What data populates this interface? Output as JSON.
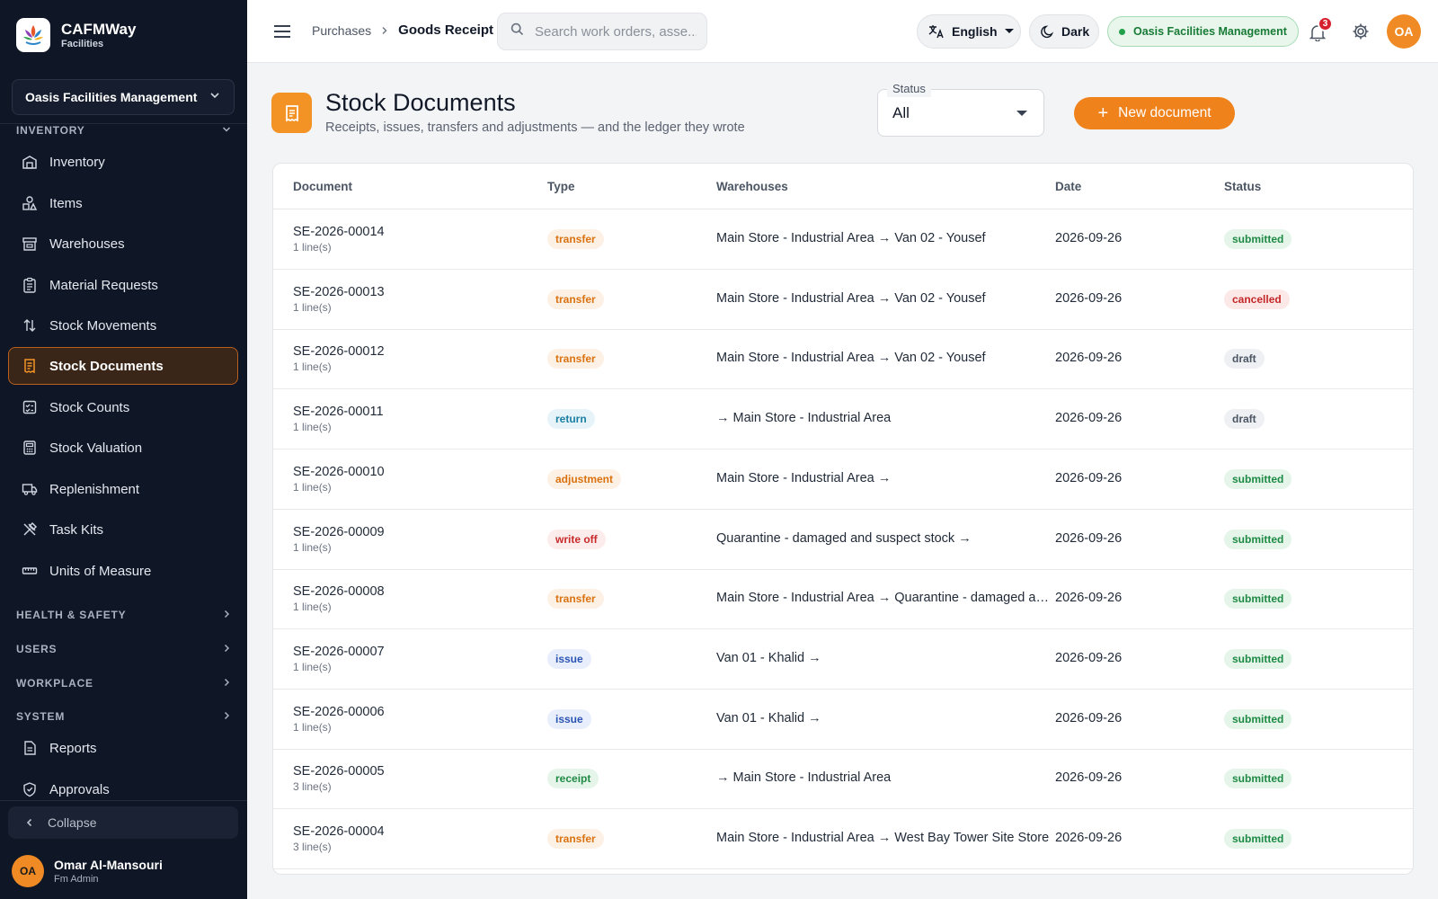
{
  "app": {
    "brand_name": "CAFMWay",
    "brand_sub": "Facilities",
    "org_selector": "Oasis Facilities Management"
  },
  "sidebar": {
    "section_inventory": "INVENTORY",
    "items": [
      {
        "label": "Inventory",
        "icon": "warehouse-icon"
      },
      {
        "label": "Items",
        "icon": "shapes-icon"
      },
      {
        "label": "Warehouses",
        "icon": "store-icon"
      },
      {
        "label": "Material Requests",
        "icon": "clipboard-icon"
      },
      {
        "label": "Stock Movements",
        "icon": "arrows-icon"
      },
      {
        "label": "Stock Documents",
        "icon": "receipt-icon"
      },
      {
        "label": "Stock Counts",
        "icon": "checklist-icon"
      },
      {
        "label": "Stock Valuation",
        "icon": "calculator-icon"
      },
      {
        "label": "Replenishment",
        "icon": "truck-icon"
      },
      {
        "label": "Task Kits",
        "icon": "tools-icon"
      },
      {
        "label": "Units of Measure",
        "icon": "ruler-icon"
      }
    ],
    "active_item": "Stock Documents",
    "sections": [
      "HEALTH & SAFETY",
      "USERS",
      "WORKPLACE",
      "SYSTEM"
    ],
    "system_items": [
      {
        "label": "Reports",
        "icon": "report-icon"
      },
      {
        "label": "Approvals",
        "icon": "shield-check-icon"
      }
    ],
    "collapse_label": "Collapse",
    "user": {
      "initials": "OA",
      "name": "Omar Al-Mansouri",
      "role": "Fm Admin"
    }
  },
  "topbar": {
    "breadcrumb": [
      "Purchases",
      "Goods Receipt"
    ],
    "search_placeholder": "Search work orders, asse...",
    "language": "English",
    "theme": "Dark",
    "org_chip": "Oasis Facilities Management",
    "notification_count": "3",
    "avatar_initials": "OA"
  },
  "page": {
    "title": "Stock Documents",
    "subtitle": "Receipts, issues, transfers and adjustments — and the ledger they wrote",
    "status_filter_label": "Status",
    "status_filter_value": "All",
    "new_button_label": "New document"
  },
  "table": {
    "columns": [
      "Document",
      "Type",
      "Warehouses",
      "Date",
      "Status"
    ],
    "rows": [
      {
        "doc": "SE-2026-00014",
        "lines": "1 line(s)",
        "type": "transfer",
        "warehouses": "Main Store - Industrial Area → Van 02 - Yousef",
        "date": "2026-09-26",
        "status": "submitted"
      },
      {
        "doc": "SE-2026-00013",
        "lines": "1 line(s)",
        "type": "transfer",
        "warehouses": "Main Store - Industrial Area → Van 02 - Yousef",
        "date": "2026-09-26",
        "status": "cancelled"
      },
      {
        "doc": "SE-2026-00012",
        "lines": "1 line(s)",
        "type": "transfer",
        "warehouses": "Main Store - Industrial Area → Van 02 - Yousef",
        "date": "2026-09-26",
        "status": "draft"
      },
      {
        "doc": "SE-2026-00011",
        "lines": "1 line(s)",
        "type": "return",
        "warehouses": "→ Main Store - Industrial Area",
        "date": "2026-09-26",
        "status": "draft"
      },
      {
        "doc": "SE-2026-00010",
        "lines": "1 line(s)",
        "type": "adjustment",
        "warehouses": "Main Store - Industrial Area →",
        "date": "2026-09-26",
        "status": "submitted"
      },
      {
        "doc": "SE-2026-00009",
        "lines": "1 line(s)",
        "type": "write off",
        "warehouses": "Quarantine - damaged and suspect stock →",
        "date": "2026-09-26",
        "status": "submitted"
      },
      {
        "doc": "SE-2026-00008",
        "lines": "1 line(s)",
        "type": "transfer",
        "warehouses": "Main Store - Industrial Area → Quarantine - damaged and suspect stock",
        "date": "2026-09-26",
        "status": "submitted"
      },
      {
        "doc": "SE-2026-00007",
        "lines": "1 line(s)",
        "type": "issue",
        "warehouses": "Van 01 - Khalid →",
        "date": "2026-09-26",
        "status": "submitted"
      },
      {
        "doc": "SE-2026-00006",
        "lines": "1 line(s)",
        "type": "issue",
        "warehouses": "Van 01 - Khalid →",
        "date": "2026-09-26",
        "status": "submitted"
      },
      {
        "doc": "SE-2026-00005",
        "lines": "3 line(s)",
        "type": "receipt",
        "warehouses": "→ Main Store - Industrial Area",
        "date": "2026-09-26",
        "status": "submitted"
      },
      {
        "doc": "SE-2026-00004",
        "lines": "3 line(s)",
        "type": "transfer",
        "warehouses": "Main Store - Industrial Area → West Bay Tower Site Store",
        "date": "2026-09-26",
        "status": "submitted"
      }
    ]
  },
  "colors": {
    "accent": "#f0821c",
    "sidebar_bg": "#0f1626",
    "success": "#1e8a45",
    "danger": "#c42727"
  }
}
